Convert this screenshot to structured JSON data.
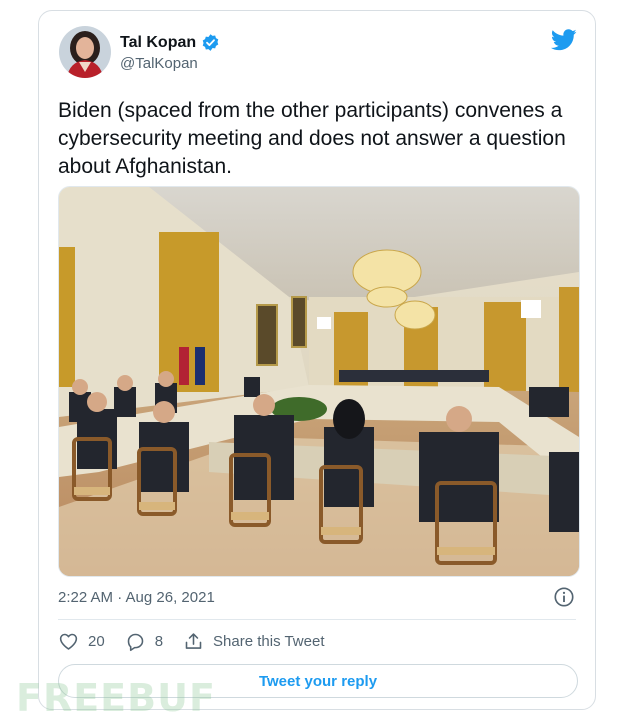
{
  "author": {
    "name": "Tal Kopan",
    "handle": "@TalKopan",
    "verified": true
  },
  "tweet": {
    "text": "Biden (spaced from the other participants) convenes a cybersecurity meeting and does not answer a question about Afghanistan.",
    "timestamp": "2:22 AM · Aug 26, 2021"
  },
  "actions": {
    "likes": "20",
    "replies": "8",
    "share_label": "Share this Tweet",
    "reply_button": "Tweet your reply"
  },
  "watermark": {
    "text": "FREEBUF"
  },
  "colors": {
    "twitter_blue": "#1d9bf0",
    "verified_blue": "#1d9bf0",
    "muted_text": "#536471",
    "border": "#cfd9de"
  },
  "icons": {
    "brand": "twitter-bird-icon",
    "verified": "verified-badge-icon",
    "info": "info-icon",
    "like": "heart-icon",
    "reply": "reply-bubble-icon",
    "share": "share-icon"
  }
}
